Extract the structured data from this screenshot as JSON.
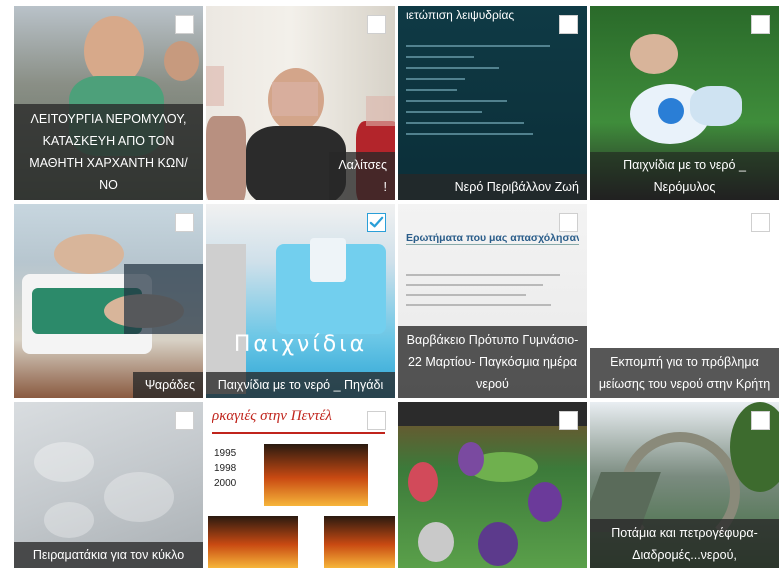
{
  "tiles": [
    {
      "caption": "ΛΕΙΤΟΥΡΓΙΑ ΝΕΡΟΜΥΛΟΥ, ΚΑΤΑΣΚΕΥΗ ΑΠΟ ΤΟΝ ΜΑΘΗΤΗ ΧΑΡΧΑΝΤΗ ΚΩΝ/ΝΟ",
      "checked": false
    },
    {
      "caption": "Λαλίτσες !",
      "checked": false
    },
    {
      "caption": "Νερό Περιβάλλον Ζωή",
      "checked": false,
      "slide_title": "ιετώπιση λειψυδρίας"
    },
    {
      "caption": "Παιχνίδια με το νερό _ Νερόμυλος",
      "checked": false
    },
    {
      "caption": "Ψαράδες",
      "checked": false
    },
    {
      "caption": "Παιχνίδια με το νερό _ Πηγάδι",
      "checked": true,
      "overlay_text": "Παιχνίδια"
    },
    {
      "caption": "Βαρβάκειο Πρότυπο Γυμνάσιο- 22 Μαρτίου- Παγκόσμια ημέρα νερού",
      "checked": false,
      "slide_title": "Ερωτήματα που μας απασχόλησαν"
    },
    {
      "caption": "Εκπομπή για το πρόβλημα μείωσης του νερού στην Κρήτη",
      "checked": false
    },
    {
      "caption": "Πειραματάκια για τον κύκλο",
      "checked": false
    },
    {
      "caption": "",
      "checked": false,
      "slide_title": "ρκαγιές στην Πεντέλ",
      "years": [
        "1995",
        "1998",
        "2000"
      ]
    },
    {
      "caption": "",
      "checked": false
    },
    {
      "caption": "Ποτάμια και πετρογέφυρα- Διαδρομές...νερού,",
      "checked": false
    }
  ],
  "colors": {
    "caption_bg": "#282828",
    "check_accent": "#2a9fd8"
  }
}
